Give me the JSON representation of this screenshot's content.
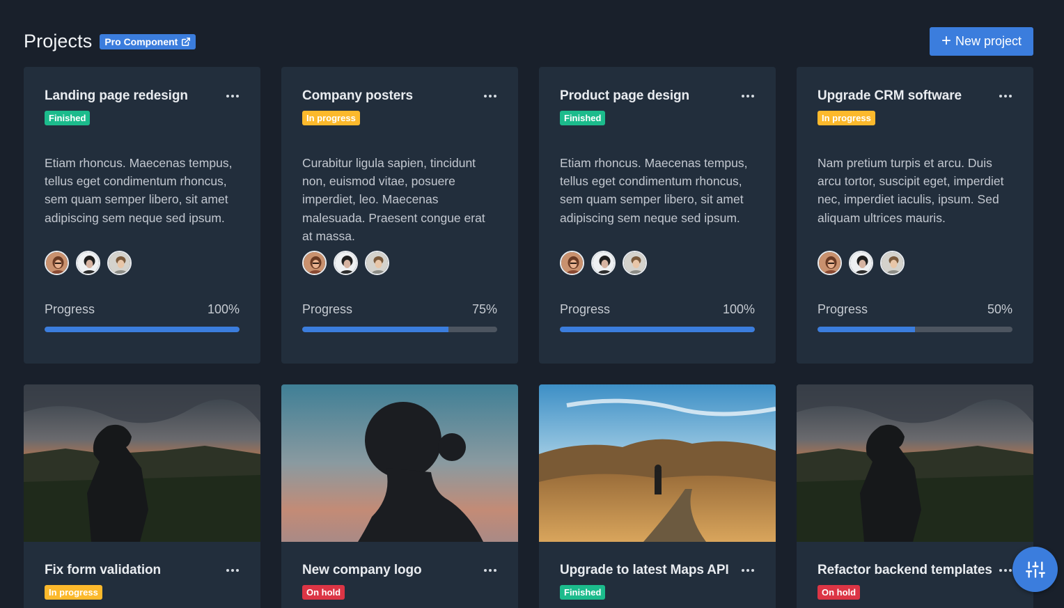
{
  "header": {
    "title": "Projects",
    "pro_badge": "Pro Component",
    "new_project": "New project"
  },
  "cards": [
    {
      "title": "Landing page redesign",
      "status": "Finished",
      "description": "Etiam rhoncus. Maecenas tempus, tellus eget condimentum rhoncus, sem quam semper libero, sit amet adipiscing sem neque sed ipsum.",
      "progress_label": "Progress",
      "progress_text": "100%",
      "progress": 100
    },
    {
      "title": "Company posters",
      "status": "In progress",
      "description": "Curabitur ligula sapien, tincidunt non, euismod vitae, posuere imperdiet, leo. Maecenas malesuada. Praesent congue erat at massa.",
      "progress_label": "Progress",
      "progress_text": "75%",
      "progress": 75
    },
    {
      "title": "Product page design",
      "status": "Finished",
      "description": "Etiam rhoncus. Maecenas tempus, tellus eget condimentum rhoncus, sem quam semper libero, sit amet adipiscing sem neque sed ipsum.",
      "progress_label": "Progress",
      "progress_text": "100%",
      "progress": 100
    },
    {
      "title": "Upgrade CRM software",
      "status": "In progress",
      "description": "Nam pretium turpis et arcu. Duis arcu tortor, suscipit eget, imperdiet nec, imperdiet iaculis, ipsum. Sed aliquam ultrices mauris.",
      "progress_label": "Progress",
      "progress_text": "50%",
      "progress": 50
    }
  ],
  "image_cards": [
    {
      "title": "Fix form validation",
      "status": "In progress"
    },
    {
      "title": "New company logo",
      "status": "On hold"
    },
    {
      "title": "Upgrade to latest Maps API",
      "status": "Finished"
    },
    {
      "title": "Refactor backend templates",
      "status": "On hold"
    }
  ],
  "colors": {
    "background": "#19202b",
    "card": "#222e3c",
    "primary": "#3b7ddd",
    "finished": "#1cbb8c",
    "in_progress": "#fcb92c",
    "on_hold": "#dc3545"
  },
  "icons": {
    "more": "more-dots-icon",
    "external": "external-link-icon",
    "plus": "plus-icon",
    "settings": "sliders-icon"
  }
}
